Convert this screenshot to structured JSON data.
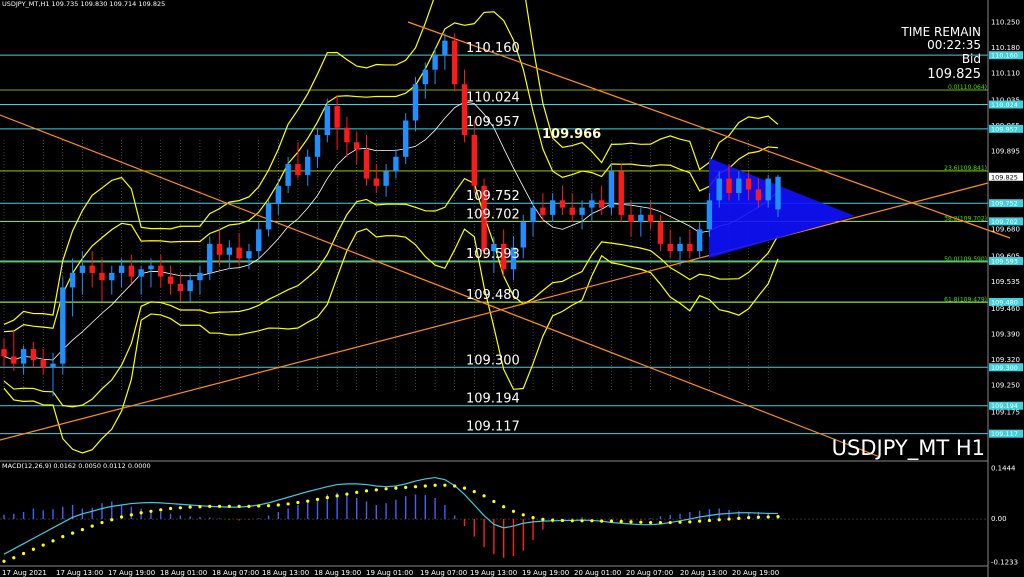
{
  "header": {
    "symbol_info": "USDJPY_MT,H1  109.735 109.830 109.714 109.825",
    "time_remain_label": "TIME REMAIN",
    "time_remain_value": "00:22:35",
    "bid_label": "Bid",
    "bid_value": "109.825",
    "symbol_watermark": "USDJPY_MT H1",
    "macd_label": "MACD(12,26,9) 0.0162 0.0050 0.0112 0.0000",
    "highlight_price": "109.966"
  },
  "colors": {
    "bull": "#1e90ff",
    "bear": "#ff1a1a",
    "bollinger": "#ffff00",
    "trendline": "#ff8c1a",
    "level_line": "#40d0e0",
    "fib_line": "#b8e600",
    "macd_line": "#40c8e0",
    "signal_dots": "#ffff00",
    "triangle": "#1010ff"
  },
  "chart_data": {
    "type": "candlestick",
    "symbol": "USDJPY_MT",
    "timeframe": "H1",
    "ylim": [
      109.05,
      110.29
    ],
    "y_ticks": [
      "110.250",
      "110.180",
      "110.110",
      "110.035",
      "109.965",
      "109.895",
      "109.825",
      "109.750",
      "109.680",
      "109.605",
      "109.535",
      "109.460",
      "109.390",
      "109.320",
      "109.250",
      "109.175"
    ],
    "x_ticks": [
      "17 Aug 2021",
      "17 Aug 13:00",
      "17 Aug 19:00",
      "18 Aug 01:00",
      "18 Aug 07:00",
      "18 Aug 13:00",
      "18 Aug 19:00",
      "19 Aug 01:00",
      "19 Aug 07:00",
      "19 Aug 13:00",
      "19 Aug 19:00",
      "20 Aug 01:00",
      "20 Aug 07:00",
      "20 Aug 13:00",
      "20 Aug 19:00"
    ],
    "levels": [
      {
        "value": 110.16,
        "label": "110.160",
        "tag": "110.160"
      },
      {
        "value": 110.024,
        "label": "110.024",
        "tag": "110.024"
      },
      {
        "value": 109.957,
        "label": "109.957",
        "tag": "109.957"
      },
      {
        "value": 109.752,
        "label": "109.752",
        "tag": "109.752"
      },
      {
        "value": 109.702,
        "label": "109.702",
        "tag": "109.702"
      },
      {
        "value": 109.593,
        "label": "109.593",
        "tag": "109.593"
      },
      {
        "value": 109.48,
        "label": "109.480",
        "tag": "109.480"
      },
      {
        "value": 109.3,
        "label": "109.300",
        "tag": "109.300"
      },
      {
        "value": 109.194,
        "label": "109.194",
        "tag": "109.194"
      },
      {
        "value": 109.117,
        "label": "109.117",
        "tag": "109.117"
      }
    ],
    "fib_levels": [
      {
        "value": 110.064,
        "label": "0.0(110.064)"
      },
      {
        "value": 109.841,
        "label": "23.6(109.841)"
      },
      {
        "value": 109.702,
        "label": "38.2(109.702)"
      },
      {
        "value": 109.59,
        "label": "50.0(109.590)"
      },
      {
        "value": 109.479,
        "label": "61.8(109.479)"
      }
    ],
    "current_price": {
      "value": 109.825,
      "tag": "109.825"
    },
    "candles": [
      [
        109.35,
        109.38,
        109.3,
        109.33
      ],
      [
        109.33,
        109.4,
        109.29,
        109.31
      ],
      [
        109.31,
        109.36,
        109.28,
        109.35
      ],
      [
        109.35,
        109.37,
        109.3,
        109.32
      ],
      [
        109.32,
        109.35,
        109.28,
        109.3
      ],
      [
        109.3,
        109.34,
        109.22,
        109.31
      ],
      [
        109.31,
        109.55,
        109.28,
        109.52
      ],
      [
        109.52,
        109.6,
        109.44,
        109.56
      ],
      [
        109.56,
        109.62,
        109.5,
        109.58
      ],
      [
        109.58,
        109.62,
        109.52,
        109.56
      ],
      [
        109.56,
        109.6,
        109.48,
        109.54
      ],
      [
        109.54,
        109.58,
        109.5,
        109.56
      ],
      [
        109.56,
        109.6,
        109.52,
        109.58
      ],
      [
        109.58,
        109.61,
        109.53,
        109.55
      ],
      [
        109.55,
        109.58,
        109.5,
        109.57
      ],
      [
        109.57,
        109.6,
        109.52,
        109.58
      ],
      [
        109.58,
        109.61,
        109.52,
        109.55
      ],
      [
        109.55,
        109.58,
        109.5,
        109.53
      ],
      [
        109.53,
        109.56,
        109.48,
        109.51
      ],
      [
        109.51,
        109.56,
        109.48,
        109.54
      ],
      [
        109.54,
        109.58,
        109.5,
        109.56
      ],
      [
        109.56,
        109.66,
        109.54,
        109.64
      ],
      [
        109.64,
        109.68,
        109.58,
        109.61
      ],
      [
        109.61,
        109.65,
        109.57,
        109.63
      ],
      [
        109.63,
        109.67,
        109.58,
        109.6
      ],
      [
        109.6,
        109.64,
        109.57,
        109.62
      ],
      [
        109.62,
        109.7,
        109.6,
        109.68
      ],
      [
        109.68,
        109.76,
        109.66,
        109.75
      ],
      [
        109.75,
        109.82,
        109.72,
        109.8
      ],
      [
        109.8,
        109.88,
        109.78,
        109.86
      ],
      [
        109.86,
        109.92,
        109.82,
        109.83
      ],
      [
        109.83,
        109.9,
        109.8,
        109.88
      ],
      [
        109.88,
        109.96,
        109.85,
        109.94
      ],
      [
        109.94,
        110.04,
        109.92,
        110.02
      ],
      [
        110.02,
        110.05,
        109.9,
        109.96
      ],
      [
        109.96,
        109.99,
        109.88,
        109.92
      ],
      [
        109.92,
        109.95,
        109.86,
        109.9
      ],
      [
        109.9,
        109.94,
        109.8,
        109.82
      ],
      [
        109.82,
        109.86,
        109.78,
        109.8
      ],
      [
        109.8,
        109.86,
        109.77,
        109.84
      ],
      [
        109.84,
        109.9,
        109.82,
        109.88
      ],
      [
        109.88,
        110.0,
        109.86,
        109.98
      ],
      [
        109.98,
        110.1,
        109.95,
        110.08
      ],
      [
        110.08,
        110.14,
        110.04,
        110.12
      ],
      [
        110.12,
        110.18,
        110.08,
        110.16
      ],
      [
        110.16,
        110.22,
        110.12,
        110.2
      ],
      [
        110.2,
        110.22,
        110.06,
        110.08
      ],
      [
        110.08,
        110.12,
        109.92,
        109.94
      ],
      [
        109.94,
        109.98,
        109.78,
        109.8
      ],
      [
        109.8,
        109.82,
        109.6,
        109.62
      ],
      [
        109.62,
        109.66,
        109.56,
        109.64
      ],
      [
        109.64,
        109.68,
        109.55,
        109.57
      ],
      [
        109.57,
        109.66,
        109.54,
        109.63
      ],
      [
        109.63,
        109.72,
        109.6,
        109.7
      ],
      [
        109.7,
        109.76,
        109.66,
        109.74
      ],
      [
        109.74,
        109.78,
        109.7,
        109.72
      ],
      [
        109.72,
        109.78,
        109.7,
        109.76
      ],
      [
        109.76,
        109.8,
        109.72,
        109.74
      ],
      [
        109.74,
        109.78,
        109.7,
        109.72
      ],
      [
        109.72,
        109.76,
        109.68,
        109.74
      ],
      [
        109.74,
        109.78,
        109.7,
        109.76
      ],
      [
        109.76,
        109.8,
        109.72,
        109.74
      ],
      [
        109.74,
        109.86,
        109.72,
        109.84
      ],
      [
        109.84,
        109.86,
        109.7,
        109.72
      ],
      [
        109.72,
        109.76,
        109.66,
        109.7
      ],
      [
        109.7,
        109.74,
        109.66,
        109.72
      ],
      [
        109.72,
        109.76,
        109.68,
        109.7
      ],
      [
        109.7,
        109.72,
        109.62,
        109.64
      ],
      [
        109.64,
        109.68,
        109.6,
        109.62
      ],
      [
        109.62,
        109.66,
        109.58,
        109.64
      ],
      [
        109.64,
        109.68,
        109.6,
        109.62
      ],
      [
        109.62,
        109.7,
        109.6,
        109.68
      ],
      [
        109.68,
        109.78,
        109.66,
        109.76
      ],
      [
        109.76,
        109.84,
        109.74,
        109.82
      ],
      [
        109.82,
        109.86,
        109.76,
        109.78
      ],
      [
        109.78,
        109.84,
        109.76,
        109.82
      ],
      [
        109.82,
        109.84,
        109.76,
        109.79
      ],
      [
        109.79,
        109.82,
        109.74,
        109.76
      ],
      [
        109.76,
        109.83,
        109.74,
        109.82
      ],
      [
        109.735,
        109.83,
        109.714,
        109.825
      ]
    ],
    "macd_ylim": [
      -0.125,
      0.148
    ],
    "macd_ticks": [
      "0.1444",
      "0.00",
      "-0.1233"
    ],
    "macd_hist": [
      0.012,
      0.015,
      0.02,
      0.03,
      0.025,
      0.028,
      0.035,
      0.04,
      0.03,
      0.032,
      0.045,
      0.05,
      0.04,
      0.035,
      0.03,
      0.025,
      0.02,
      0.015,
      0.01,
      0.008,
      0.006,
      0.004,
      0.002,
      -0.002,
      -0.004,
      -0.002,
      0.002,
      0.01,
      0.02,
      0.03,
      0.04,
      0.05,
      0.06,
      0.07,
      0.075,
      0.07,
      0.06,
      0.05,
      0.04,
      0.045,
      0.055,
      0.065,
      0.07,
      0.068,
      0.06,
      0.04,
      0.01,
      -0.02,
      -0.05,
      -0.08,
      -0.1,
      -0.11,
      -0.105,
      -0.09,
      -0.06,
      -0.03,
      -0.01,
      -0.005,
      0.002,
      0.005,
      -0.004,
      -0.008,
      -0.01,
      -0.006,
      -0.004,
      -0.002,
      0.002,
      0.008,
      0.012,
      0.015,
      0.02,
      0.024,
      0.028,
      0.03,
      0.026,
      0.022,
      0.018,
      0.02,
      0.015,
      0.012
    ],
    "macd_line": [
      -0.1,
      -0.085,
      -0.07,
      -0.055,
      -0.04,
      -0.025,
      -0.01,
      0.005,
      0.015,
      0.022,
      0.03,
      0.036,
      0.04,
      0.044,
      0.046,
      0.047,
      0.046,
      0.044,
      0.042,
      0.04,
      0.038,
      0.036,
      0.035,
      0.034,
      0.034,
      0.036,
      0.04,
      0.046,
      0.054,
      0.062,
      0.07,
      0.078,
      0.085,
      0.092,
      0.098,
      0.1,
      0.1,
      0.098,
      0.094,
      0.092,
      0.094,
      0.1,
      0.108,
      0.114,
      0.118,
      0.112,
      0.095,
      0.07,
      0.04,
      0.01,
      -0.015,
      -0.025,
      -0.02,
      -0.012,
      -0.008,
      -0.006,
      -0.005,
      -0.004,
      -0.004,
      -0.003,
      -0.004,
      -0.006,
      -0.01,
      -0.012,
      -0.014,
      -0.016,
      -0.016,
      -0.014,
      -0.01,
      -0.005,
      0.0,
      0.006,
      0.01,
      0.014,
      0.016,
      0.018,
      0.018,
      0.017,
      0.016,
      0.016
    ],
    "signal_line": [
      -0.12,
      -0.11,
      -0.098,
      -0.086,
      -0.074,
      -0.062,
      -0.05,
      -0.04,
      -0.03,
      -0.02,
      -0.01,
      -0.002,
      0.006,
      0.012,
      0.018,
      0.022,
      0.026,
      0.03,
      0.032,
      0.034,
      0.035,
      0.036,
      0.036,
      0.036,
      0.036,
      0.036,
      0.037,
      0.038,
      0.04,
      0.043,
      0.047,
      0.051,
      0.056,
      0.061,
      0.066,
      0.071,
      0.076,
      0.08,
      0.083,
      0.086,
      0.088,
      0.09,
      0.092,
      0.094,
      0.096,
      0.096,
      0.094,
      0.088,
      0.078,
      0.066,
      0.05,
      0.035,
      0.022,
      0.012,
      0.004,
      -0.001,
      -0.003,
      -0.004,
      -0.005,
      -0.005,
      -0.005,
      -0.006,
      -0.006,
      -0.007,
      -0.008,
      -0.009,
      -0.01,
      -0.01,
      -0.01,
      -0.009,
      -0.008,
      -0.006,
      -0.004,
      -0.002,
      0.0,
      0.002,
      0.004,
      0.005,
      0.006,
      0.007
    ]
  }
}
